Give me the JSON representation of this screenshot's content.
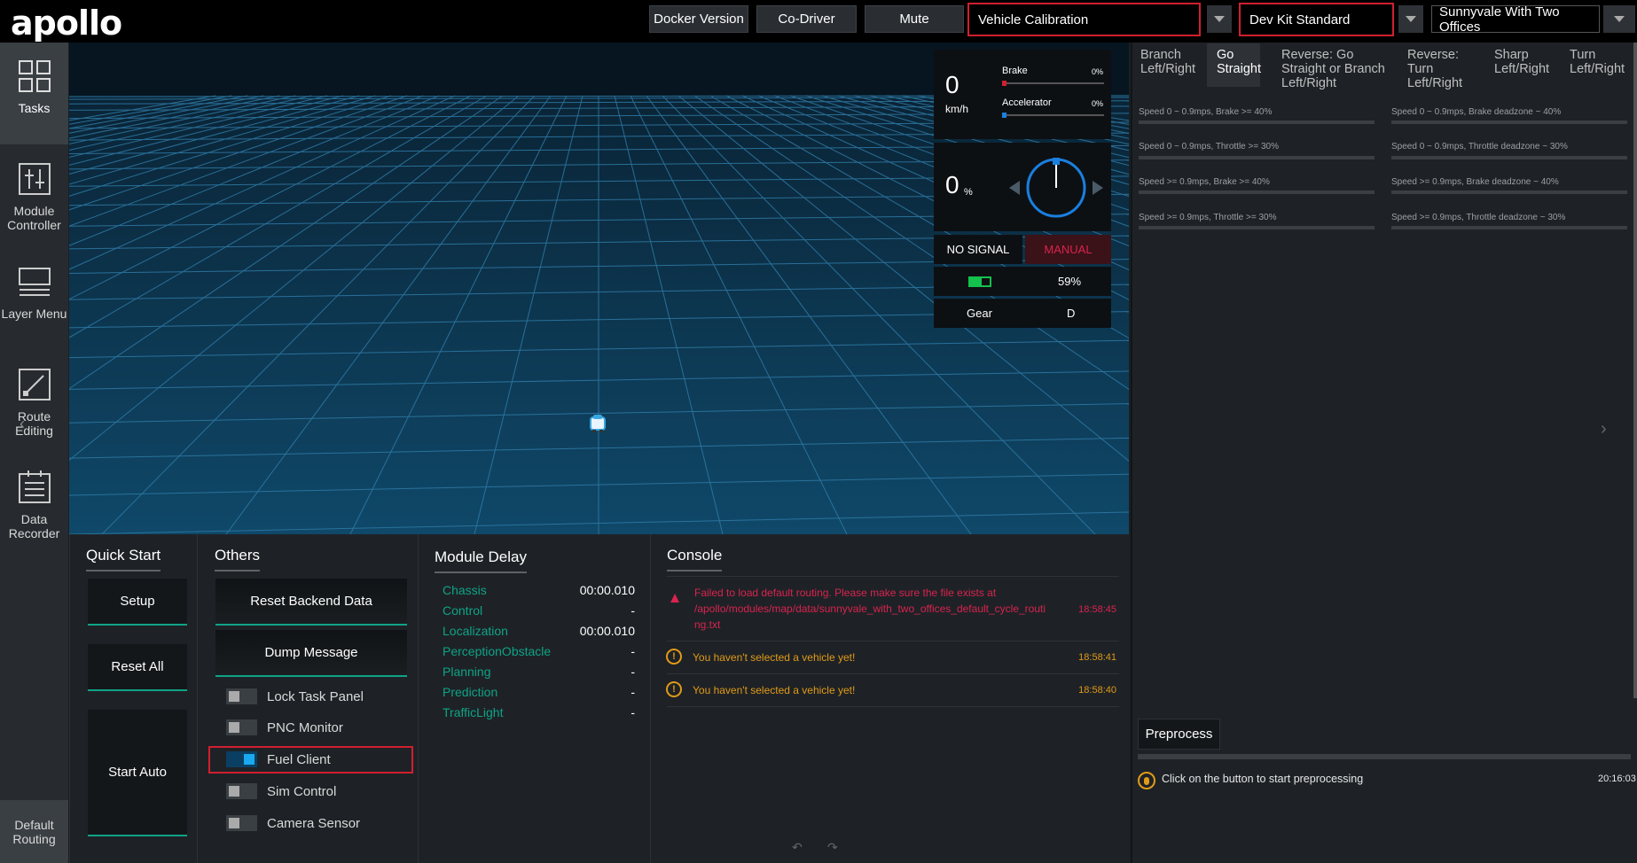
{
  "header": {
    "logo": "apollo",
    "buttons": [
      "Docker Version",
      "Co-Driver",
      "Mute"
    ],
    "mode_select": "Vehicle Calibration",
    "vehicle_select": "Dev Kit Standard",
    "map_select": "Sunnyvale With Two Offices"
  },
  "sidebar": {
    "items": [
      {
        "label": "Tasks",
        "icon": "grid-icon"
      },
      {
        "label": "Module Controller",
        "icon": "sliders-icon"
      },
      {
        "label": "Layer Menu",
        "icon": "layers-icon"
      },
      {
        "label": "Route Editing",
        "icon": "route-icon"
      },
      {
        "label": "Data Recorder",
        "icon": "recorder-icon"
      }
    ],
    "footer": "Default Routing"
  },
  "dashboard": {
    "speed": "0",
    "speed_unit": "km/h",
    "brake_label": "Brake",
    "brake_value": "0%",
    "accel_label": "Accelerator",
    "accel_value": "0%",
    "steering": "0",
    "steering_unit": "%",
    "signal": "NO SIGNAL",
    "drive_mode": "MANUAL",
    "battery": "59%",
    "battery_level": 0.59,
    "gear_label": "Gear",
    "gear_value": "D"
  },
  "quick_start": {
    "title": "Quick Start",
    "setup": "Setup",
    "reset_all": "Reset All",
    "start_auto": "Start Auto"
  },
  "others": {
    "title": "Others",
    "reset_backend": "Reset Backend Data",
    "dump_message": "Dump Message",
    "toggles": [
      {
        "label": "Lock Task Panel",
        "on": false
      },
      {
        "label": "PNC Monitor",
        "on": false
      },
      {
        "label": "Fuel Client",
        "on": true
      },
      {
        "label": "Sim Control",
        "on": false
      },
      {
        "label": "Camera Sensor",
        "on": false
      }
    ]
  },
  "module_delay": {
    "title": "Module Delay",
    "rows": [
      {
        "name": "Chassis",
        "value": "00:00.010"
      },
      {
        "name": "Control",
        "value": "-"
      },
      {
        "name": "Localization",
        "value": "00:00.010"
      },
      {
        "name": "PerceptionObstacle",
        "value": "-"
      },
      {
        "name": "Planning",
        "value": "-"
      },
      {
        "name": "Prediction",
        "value": "-"
      },
      {
        "name": "TrafficLight",
        "value": "-"
      }
    ]
  },
  "console": {
    "title": "Console",
    "messages": [
      {
        "level": "error",
        "text": "Failed to load default routing. Please make sure the file exists at /apollo/modules/map/data/sunnyvale_with_two_offices_default_cycle_routi ng.txt",
        "time": "18:58:45"
      },
      {
        "level": "warn",
        "text": "You haven't selected a vehicle yet!",
        "time": "18:58:41"
      },
      {
        "level": "warn",
        "text": "You haven't selected a vehicle yet!",
        "time": "18:58:40"
      }
    ],
    "colors": {
      "error": "#d9234f",
      "warn": "#e19a19"
    }
  },
  "calibration": {
    "tabs": [
      {
        "label": "Branch Left/Right",
        "active": false
      },
      {
        "label": "Go Straight",
        "active": true
      },
      {
        "label": "Reverse: Go Straight or Branch Left/Right",
        "active": false
      },
      {
        "label": "Reverse: Turn Left/Right",
        "active": false
      },
      {
        "label": "Sharp Left/Right",
        "active": false
      },
      {
        "label": "Turn Left/Right",
        "active": false
      }
    ],
    "metrics": [
      "Speed 0 ~ 0.9mps, Brake >= 40%",
      "Speed 0 ~ 0.9mps, Brake deadzone ~ 40%",
      "Speed 0 ~ 0.9mps, Throttle >= 30%",
      "Speed 0 ~ 0.9mps, Throttle deadzone ~ 30%",
      "Speed >= 0.9mps, Brake >= 40%",
      "Speed >= 0.9mps, Brake deadzone ~ 40%",
      "Speed >= 0.9mps, Throttle >= 30%",
      "Speed >= 0.9mps, Throttle deadzone ~ 30%"
    ],
    "preprocess_button": "Preprocess",
    "preprocess_message": "Click on the button to start preprocessing",
    "preprocess_time": "20:16:03"
  },
  "accent_colors": {
    "highlight": "#d11f2f",
    "teal": "#0fa386",
    "blue": "#1aa9ee"
  }
}
